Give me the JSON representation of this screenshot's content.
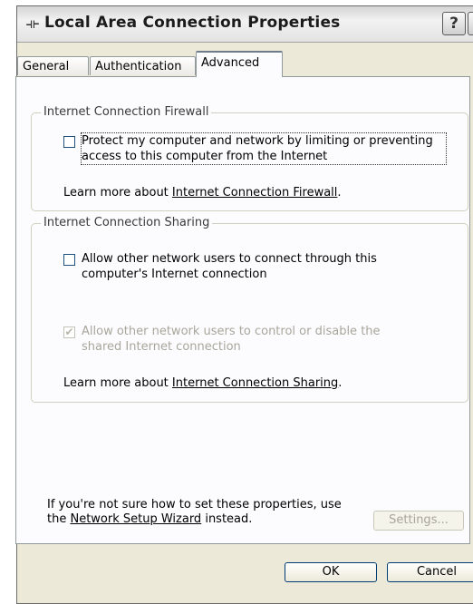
{
  "window": {
    "title": "Local Area Connection Properties",
    "help_glyph": "?",
    "close_glyph": "✕"
  },
  "tabs": [
    {
      "label": "General"
    },
    {
      "label": "Authentication"
    },
    {
      "label": "Advanced"
    }
  ],
  "firewall": {
    "group_title": "Internet Connection Firewall",
    "checkbox_line1": "Protect my computer and network by limiting or preventing",
    "checkbox_line2": "access to this computer from the Internet",
    "checked": false,
    "learn_prefix": "Learn more about ",
    "learn_link": "Internet Connection Firewall",
    "learn_suffix": "."
  },
  "sharing": {
    "group_title": "Internet Connection Sharing",
    "allow_connect_line1": "Allow other network users to connect through this",
    "allow_connect_line2": "computer's Internet connection",
    "allow_connect_checked": false,
    "allow_control_line1": "Allow other network users to control or disable the",
    "allow_control_line2": "shared Internet connection",
    "allow_control_checked": true,
    "allow_control_enabled": false,
    "learn_prefix": "Learn more about ",
    "learn_link": "Internet Connection Sharing",
    "learn_suffix": "."
  },
  "footer": {
    "note_line1": "If you're not sure how to set these properties, use",
    "note_prefix": "the ",
    "note_link": "Network Setup Wizard",
    "note_suffix": " instead.",
    "settings_label": "Settings...",
    "ok_label": "OK",
    "cancel_label": "Cancel"
  }
}
